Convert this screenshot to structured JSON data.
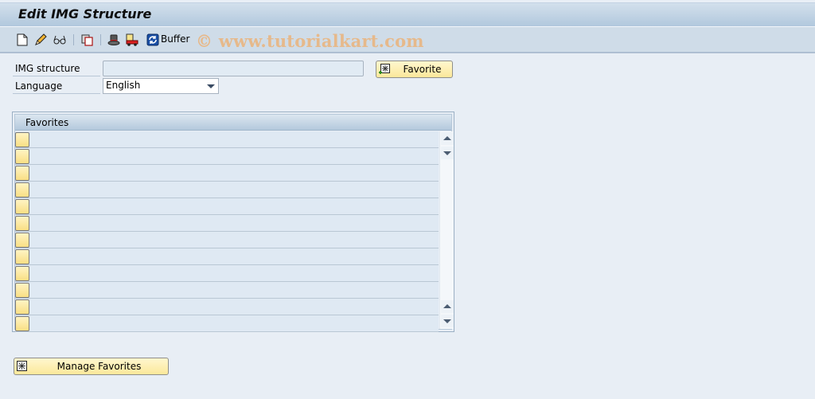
{
  "window": {
    "title": "Edit IMG Structure"
  },
  "toolbar": {
    "items": [
      {
        "icon": "new-document-icon",
        "label": ""
      },
      {
        "icon": "edit-pencil-icon",
        "label": ""
      },
      {
        "icon": "display-glasses-icon",
        "label": ""
      },
      {
        "icon": "copy-icon",
        "label": ""
      },
      {
        "icon": "transport-hat-icon",
        "label": ""
      },
      {
        "icon": "transport-truck-icon",
        "label": ""
      },
      {
        "icon": "refresh-buffer-icon",
        "label": "Buffer"
      }
    ],
    "buffer_label": "Buffer"
  },
  "watermark": "© www.tutorialkart.com",
  "form": {
    "img_structure": {
      "label": "IMG structure",
      "value": ""
    },
    "language": {
      "label": "Language",
      "value": "English"
    },
    "favorite_button": {
      "label": "Favorite",
      "icon": "add-favorite-icon"
    }
  },
  "favorites_table": {
    "header": "Favorites",
    "rows": [
      "",
      "",
      "",
      "",
      "",
      "",
      "",
      "",
      "",
      "",
      "",
      ""
    ]
  },
  "manage_button": {
    "label": "Manage Favorites",
    "icon": "favorites-icon"
  },
  "colors": {
    "button_yellow": "#fbe89a",
    "title_gradient_top": "#d3e0ec",
    "title_gradient_bottom": "#b1c8dd",
    "background": "#e8eef5",
    "watermark": "#e8b887"
  }
}
